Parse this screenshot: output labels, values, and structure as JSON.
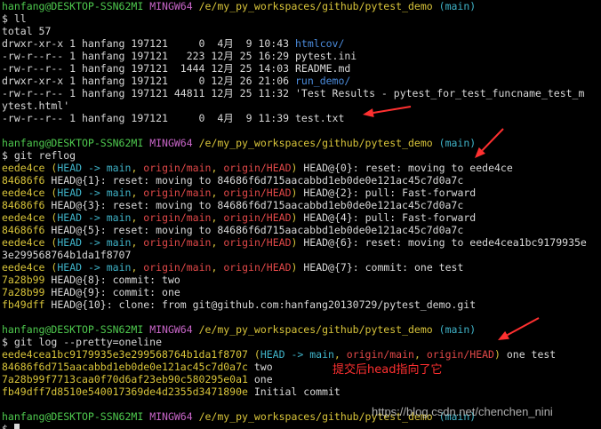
{
  "prompt_user": "hanfang@DESKTOP-SSN62MI",
  "prompt_shell": "MINGW64",
  "prompt_path": "/e/my_py_workspaces/github/pytest_demo",
  "prompt_branch": "(main)",
  "block1": {
    "command": "$ ll",
    "total": "total 57",
    "entries": [
      {
        "meta": "drwxr-xr-x 1 hanfang 197121     0  4月  9 10:43 ",
        "name": "htmlcov/",
        "color": "blue"
      },
      {
        "meta": "-rw-r--r-- 1 hanfang 197121   223 12月 25 16:29 ",
        "name": "pytest.ini",
        "color": "white"
      },
      {
        "meta": "-rw-r--r-- 1 hanfang 197121  1444 12月 25 14:03 ",
        "name": "README.md",
        "color": "white"
      },
      {
        "meta": "drwxr-xr-x 1 hanfang 197121     0 12月 26 21:06 ",
        "name": "run_demo/",
        "color": "blue"
      },
      {
        "meta": "-rw-r--r-- 1 hanfang 197121 44811 12月 25 11:32 ",
        "name": "'Test Results - pytest_for_test_funcname_test_m",
        "color": "white"
      },
      {
        "meta": "",
        "name": "ytest.html'",
        "color": "white"
      },
      {
        "meta": "-rw-r--r-- 1 hanfang 197121     0  4月  9 11:39 ",
        "name": "test.txt",
        "color": "white"
      }
    ]
  },
  "block2": {
    "command": "$ git reflog",
    "entries": [
      {
        "hash": "eede4ce",
        "refs": true,
        "text": " HEAD@{0}: reset: moving to eede4ce"
      },
      {
        "hash": "84686f6",
        "refs": false,
        "text": " HEAD@{1}: reset: moving to 84686f6d715aacabbd1eb0de0e121ac45c7d0a7c"
      },
      {
        "hash": "eede4ce",
        "refs": true,
        "text": " HEAD@{2}: pull: Fast-forward"
      },
      {
        "hash": "84686f6",
        "refs": false,
        "text": " HEAD@{3}: reset: moving to 84686f6d715aacabbd1eb0de0e121ac45c7d0a7c"
      },
      {
        "hash": "eede4ce",
        "refs": true,
        "text": " HEAD@{4}: pull: Fast-forward"
      },
      {
        "hash": "84686f6",
        "refs": false,
        "text": " HEAD@{5}: reset: moving to 84686f6d715aacabbd1eb0de0e121ac45c7d0a7c"
      },
      {
        "hash": "eede4ce",
        "refs": true,
        "text": " HEAD@{6}: reset: moving to eede4cea1bc9179935e"
      },
      {
        "hash": "",
        "refs": false,
        "text": "3e299568764b1da1f8707"
      },
      {
        "hash": "eede4ce",
        "refs": true,
        "text": " HEAD@{7}: commit: one test"
      },
      {
        "hash": "7a28b99",
        "refs": false,
        "text": " HEAD@{8}: commit: two"
      },
      {
        "hash": "7a28b99",
        "refs": false,
        "text": " HEAD@{9}: commit: one"
      },
      {
        "hash": "fb49dff",
        "refs": false,
        "text": " HEAD@{10}: clone: from git@github.com:hanfang20130729/pytest_demo.git"
      }
    ]
  },
  "refs": {
    "open": "(",
    "head": "HEAD -> main",
    "sep": ", ",
    "origin_main": "origin/main",
    "origin_head": "origin/HEAD",
    "close": ")"
  },
  "block3": {
    "command": "$ git log --pretty=oneline",
    "entries": [
      {
        "hash": "eede4cea1bc9179935e3e299568764b1da1f8707",
        "refs": true,
        "text": " one test"
      },
      {
        "hash": "84686f6d715aacabbd1eb0de0e121ac45c7d0a7c",
        "refs": false,
        "text": " two"
      },
      {
        "hash": "7a28b99f7713caa0f70d6af23eb90c580295e0a1",
        "refs": false,
        "text": " one"
      },
      {
        "hash": "fb49dff7d8510e540017369de4d2355d3471890e",
        "refs": false,
        "text": " Initial commit"
      }
    ]
  },
  "final_prompt": "$",
  "annotation": "提交后head指向了它",
  "watermark": "https://blog.csdn.net/chenchen_nini",
  "colors": {
    "prompt_user": "#4ec94e",
    "prompt_shell": "#c865c8",
    "prompt_path": "#d8c43a",
    "prompt_branch": "#3fb3c8",
    "hash": "#d8c43a",
    "dir": "#4b8bdb",
    "head_ref": "#3fb3c8",
    "origin_ref": "#e04848",
    "annotation": "#ff3030"
  }
}
